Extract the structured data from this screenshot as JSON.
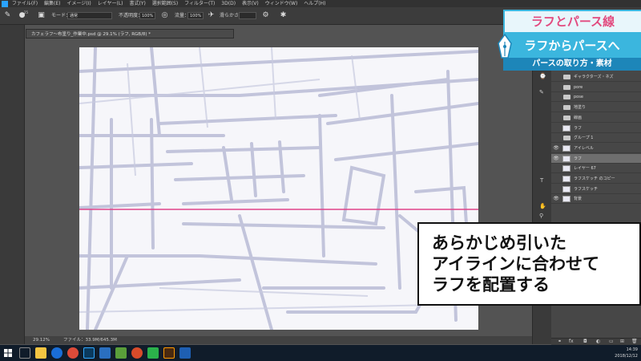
{
  "menu": [
    "ファイル(F)",
    "編集(E)",
    "イメージ(I)",
    "レイヤー(L)",
    "書式(Y)",
    "選択範囲(S)",
    "フィルター(T)",
    "3D(D)",
    "表示(V)",
    "ウィンドウ(W)",
    "ヘルプ(H)"
  ],
  "options": {
    "brush_size": "25",
    "mode_label": "モード：",
    "mode_value": "通常",
    "opacity_label": "不透明度：",
    "opacity_value": "100%",
    "flow_label": "流量：",
    "flow_value": "100%",
    "smoothing_label": "滑らかさ："
  },
  "document": {
    "tab_title": "カフェラフ～布塗り_作業中.psd @ 29.1% (ラフ, RGB/8) *",
    "zoom": "29.12%",
    "file_info": "ファイル：33.9M/645.3M"
  },
  "layers": [
    {
      "name": "ギャラクターズ・ネズ",
      "kind": "folder",
      "visible": false,
      "selected": false
    },
    {
      "name": "pore",
      "kind": "folder",
      "visible": false,
      "selected": false
    },
    {
      "name": "pose",
      "kind": "folder",
      "visible": false,
      "selected": false
    },
    {
      "name": "地塗り",
      "kind": "folder",
      "visible": false,
      "selected": false
    },
    {
      "name": "線画",
      "kind": "folder",
      "visible": false,
      "selected": false
    },
    {
      "name": "ラフ",
      "kind": "layer",
      "visible": false,
      "selected": false
    },
    {
      "name": "グループ 1",
      "kind": "folder",
      "visible": false,
      "selected": false
    },
    {
      "name": "アイレベル",
      "kind": "layer",
      "visible": true,
      "selected": false
    },
    {
      "name": "ラフ",
      "kind": "layer",
      "visible": true,
      "selected": true
    },
    {
      "name": "レイヤー 67",
      "kind": "layer",
      "visible": false,
      "selected": false
    },
    {
      "name": "ラフスケッチ のコピー",
      "kind": "layer",
      "visible": false,
      "selected": false
    },
    {
      "name": "ラフスケッチ",
      "kind": "layer",
      "visible": false,
      "selected": false
    },
    {
      "name": "背景",
      "kind": "layer",
      "visible": true,
      "selected": false
    }
  ],
  "banner": {
    "line1": "ラフとパース線",
    "line2": "ラフからパースへ",
    "line3": "パースの取り方・素材"
  },
  "caption": [
    "あらかじめ引いた",
    "アイラインに合わせて",
    "ラフを配置する"
  ],
  "taskbar": {
    "time": "14:39",
    "date": "2018/12/12"
  },
  "colors": {
    "eye_level_line": "#e0448a",
    "sketch_stroke": "#b9bcd6",
    "banner_accent": "#3bb6de",
    "banner_title": "#e24a7f"
  }
}
